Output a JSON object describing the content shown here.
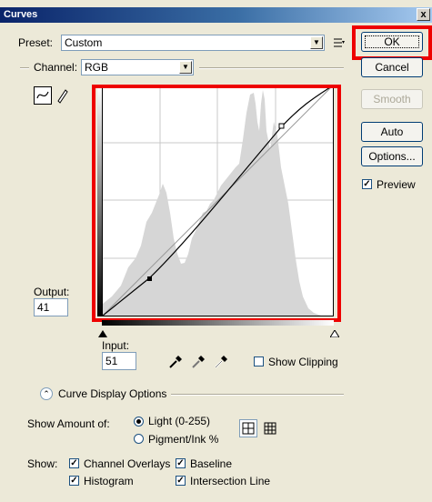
{
  "window": {
    "title": "Curves",
    "close_glyph": "x"
  },
  "preset": {
    "label": "Preset:",
    "value": "Custom"
  },
  "channel": {
    "label": "Channel:",
    "value": "RGB"
  },
  "buttons": {
    "ok": "OK",
    "cancel": "Cancel",
    "smooth": "Smooth",
    "auto": "Auto",
    "options": "Options..."
  },
  "preview": {
    "label": "Preview",
    "checked": true
  },
  "output": {
    "label": "Output:",
    "value": "41"
  },
  "input": {
    "label": "Input:",
    "value": "51"
  },
  "show_clipping": {
    "label": "Show Clipping",
    "checked": false
  },
  "curve_display_options": {
    "label": "Curve Display Options"
  },
  "show_amount": {
    "label": "Show Amount of:",
    "options": [
      {
        "label": "Light  (0-255)",
        "selected": true
      },
      {
        "label": "Pigment/Ink %",
        "selected": false
      }
    ]
  },
  "show": {
    "label": "Show:",
    "channel_overlays": "Channel Overlays",
    "baseline": "Baseline",
    "histogram": "Histogram",
    "intersection_line": "Intersection Line"
  },
  "icons": [
    "curve-tool-icon",
    "pencil-icon",
    "preset-menu-icon",
    "black-eyedropper-icon",
    "gray-eyedropper-icon",
    "white-eyedropper-icon",
    "collapse-icon",
    "grid-4x4-icon",
    "grid-10x10-icon"
  ],
  "accent": {
    "highlight": "#ee0000",
    "titlebar": "#0a246a"
  }
}
